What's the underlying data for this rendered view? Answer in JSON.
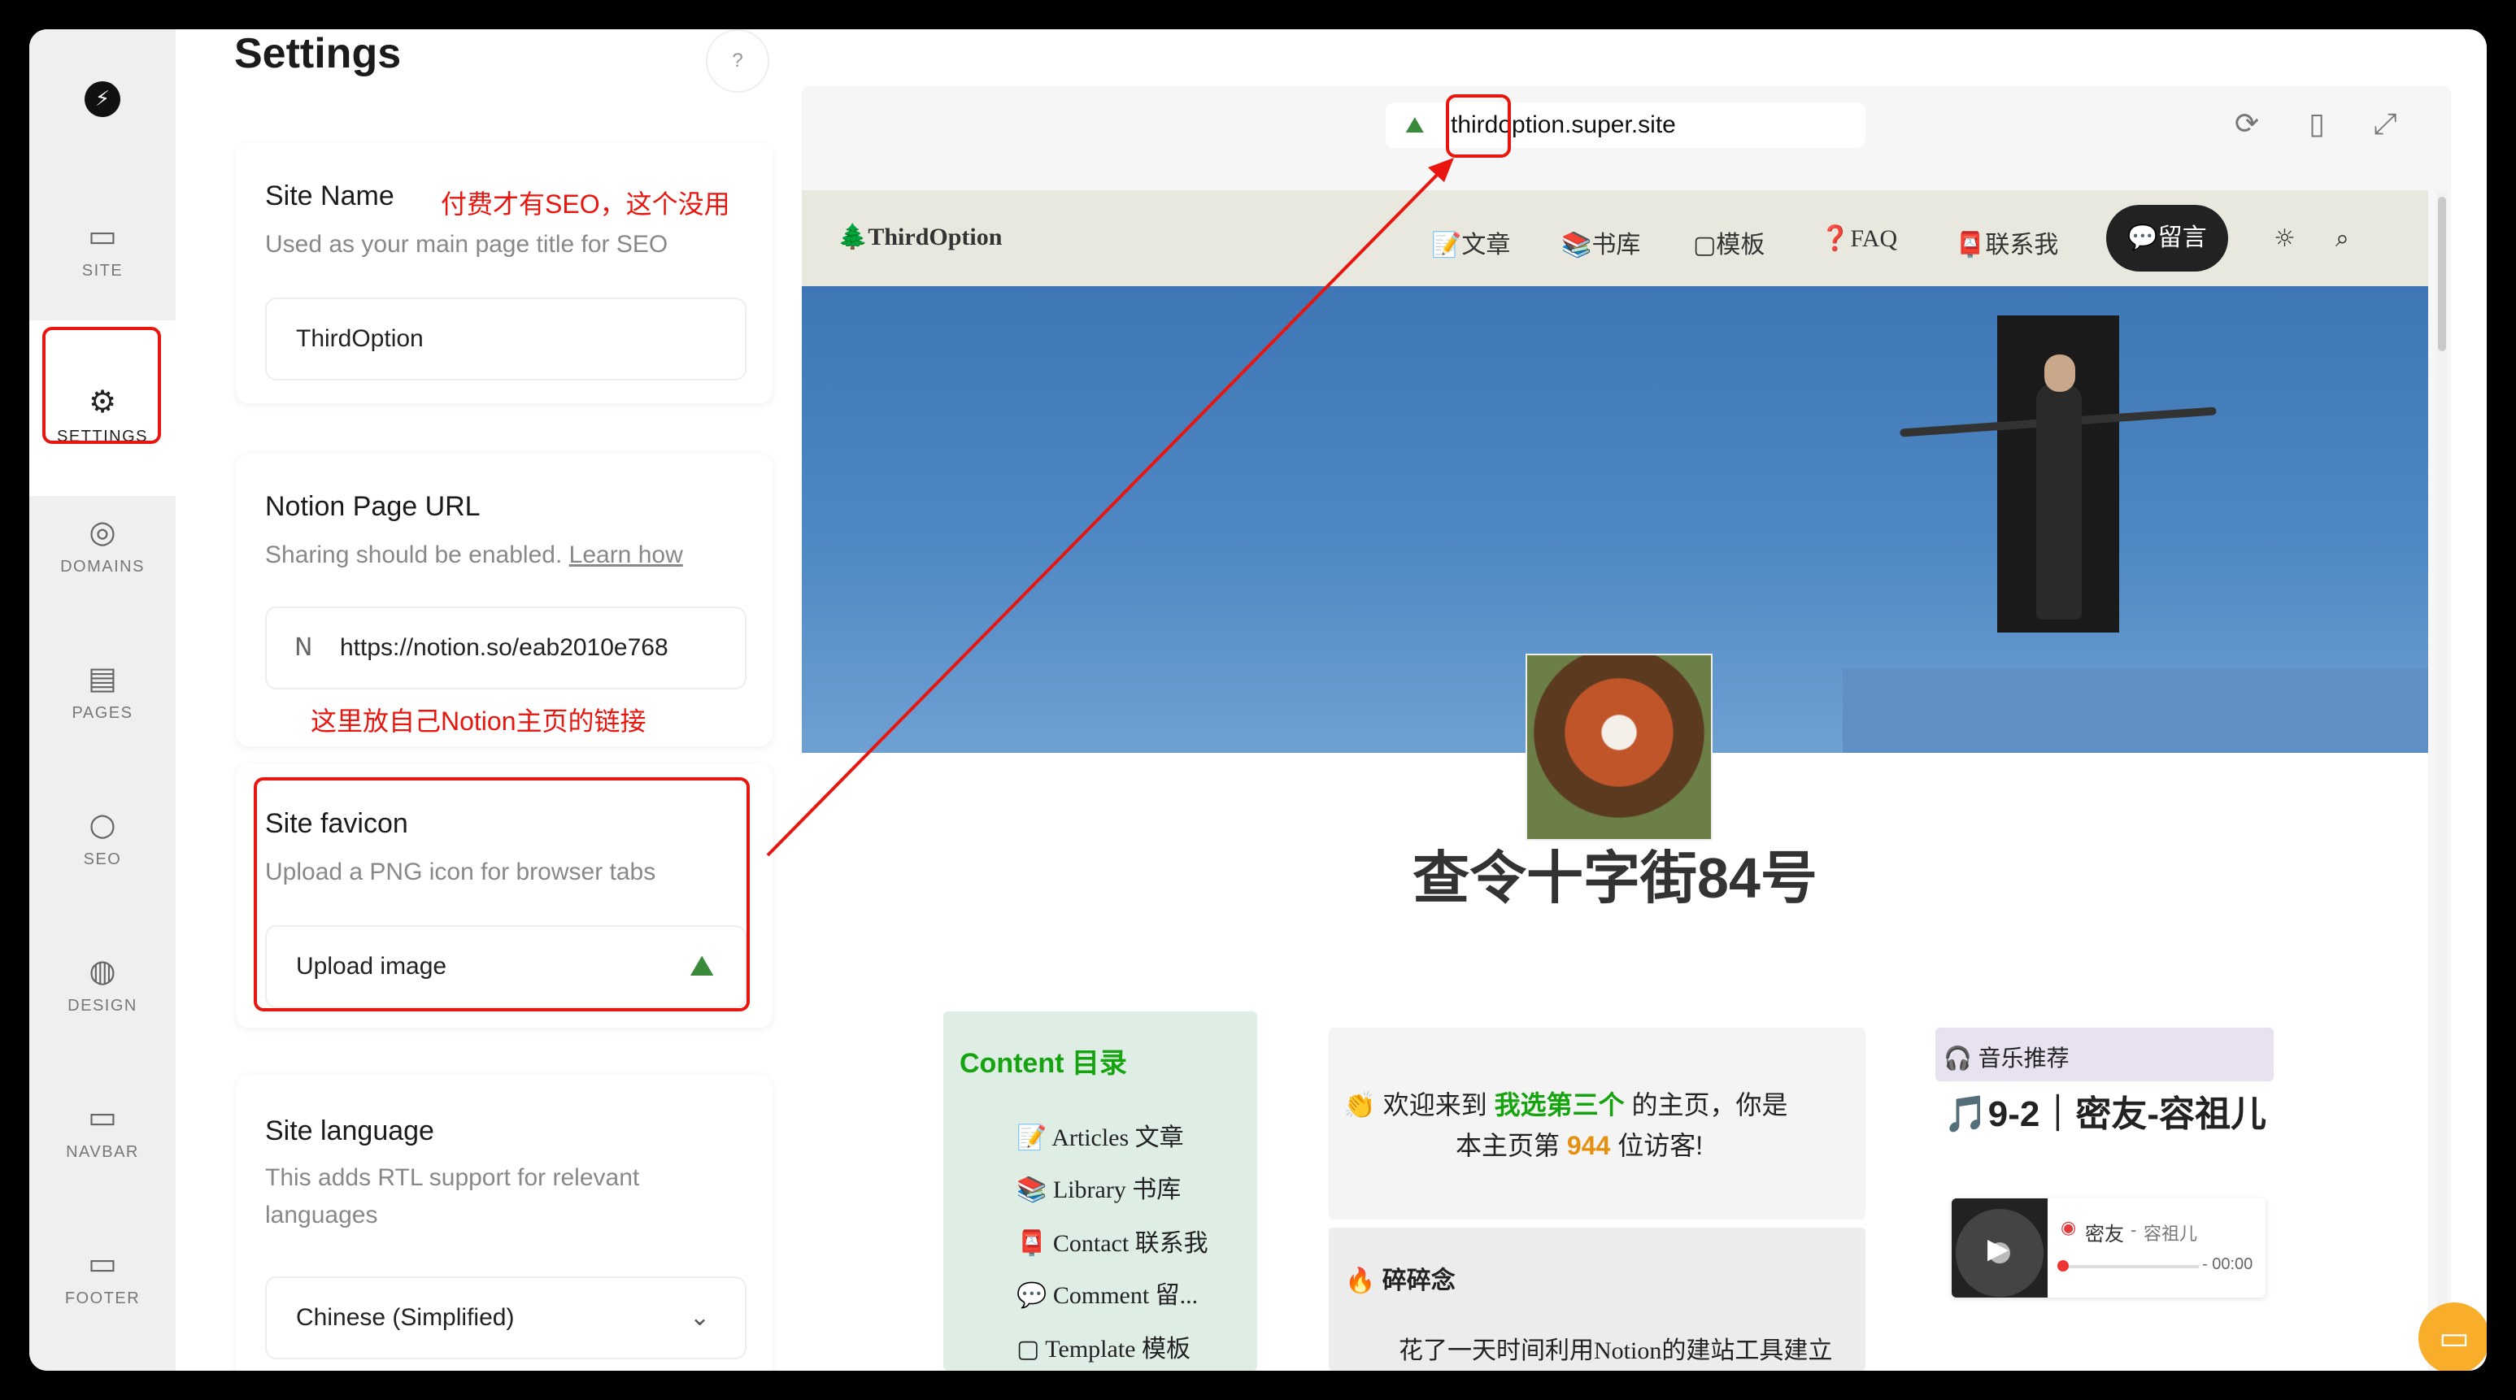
{
  "sidebar": {
    "logo": "⚡",
    "items": [
      {
        "label": "SITE",
        "icon": "monitor-icon",
        "glyph": "▭"
      },
      {
        "label": "SETTINGS",
        "icon": "gear-icon",
        "glyph": "⚙"
      },
      {
        "label": "DOMAINS",
        "icon": "globe-icon",
        "glyph": "◎"
      },
      {
        "label": "PAGES",
        "icon": "document-icon",
        "glyph": "▤"
      },
      {
        "label": "SEO",
        "icon": "search-icon",
        "glyph": "○"
      },
      {
        "label": "DESIGN",
        "icon": "palette-icon",
        "glyph": "◍"
      },
      {
        "label": "NAVBAR",
        "icon": "navbar-icon",
        "glyph": "▭"
      },
      {
        "label": "FOOTER",
        "icon": "footer-icon",
        "glyph": "▭"
      }
    ]
  },
  "settings": {
    "title": "Settings",
    "help": "?",
    "site_name": {
      "title": "Site Name",
      "desc": "Used as your main page title for SEO",
      "value": "ThirdOption",
      "note": "付费才有SEO，这个没用"
    },
    "notion_url": {
      "title": "Notion Page URL",
      "desc_prefix": "Sharing should be enabled.",
      "learn_link": "Learn how",
      "value": "https://notion.so/eab2010e768",
      "note": "这里放自己Notion主页的链接"
    },
    "favicon": {
      "title": "Site favicon",
      "desc": "Upload a PNG icon for browser tabs",
      "button": "Upload image"
    },
    "language": {
      "title": "Site language",
      "desc": "This adds RTL support for relevant languages",
      "value": "Chinese (Simplified)"
    }
  },
  "preview": {
    "url": "thirdoption.super.site",
    "toolbar": [
      "refresh-icon",
      "mobile-icon",
      "expand-icon"
    ],
    "site": {
      "brand": "🌲ThirdOption",
      "nav": [
        "📝文章",
        "📚书库",
        "▢模板",
        "❓FAQ",
        "📮联系我"
      ],
      "nav_pill": "💬留言",
      "title": "查令十字街84号",
      "toc": {
        "title": "Content 目录",
        "items": [
          "📝 Articles 文章",
          "📚 Library 书库",
          "📮 Contact 联系我",
          "💬 Comment 留...",
          "▢ Template 模板"
        ]
      },
      "welcome": {
        "prefix": "👏 欢迎来到",
        "highlight": "我选第三个",
        "suffix": "的主页，你是",
        "line2_prefix": "本主页第",
        "count": "944",
        "line2_suffix": "位访客!"
      },
      "notes": {
        "title": "🔥 碎碎念",
        "body": "花了一天时间利用Notion的建站工具建立"
      },
      "music": {
        "label": "🎧 音乐推荐",
        "title": "🎵9-2｜密友-容祖儿",
        "song": "密友",
        "artist": "容祖儿",
        "time": "- 00:00"
      }
    }
  },
  "colors": {
    "annotation_red": "#e8160f",
    "accent_green": "#16a310",
    "accent_orange": "#e6900f",
    "chat_button": "#f8ad2b"
  }
}
